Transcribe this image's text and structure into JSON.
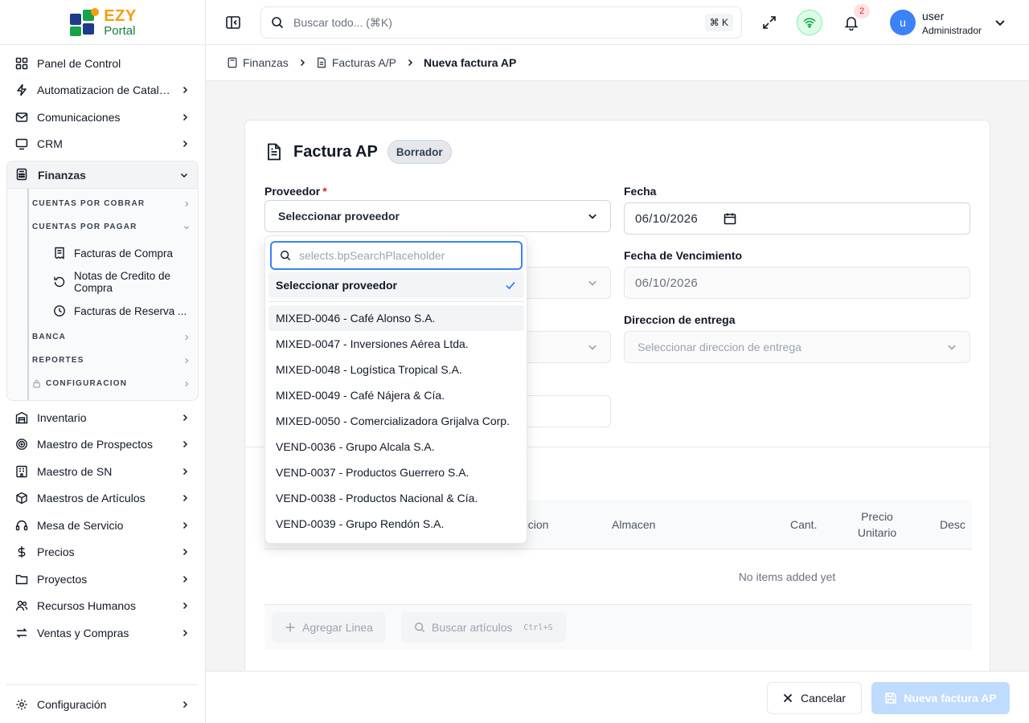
{
  "brand": {
    "name_top": "EZY",
    "name_bottom": "Portal"
  },
  "topbar": {
    "search_placeholder": "Buscar todo... (⌘K)",
    "search_shortcut": "⌘ K",
    "notification_count": "2",
    "user_initial": "u",
    "user_name": "user",
    "user_role": "Administrador"
  },
  "sidebar": {
    "items_top": [
      {
        "label": "Panel de Control",
        "icon": "layout-grid-icon"
      },
      {
        "label": "Automatizacion de Catalogos",
        "icon": "zap-icon"
      },
      {
        "label": "Comunicaciones",
        "icon": "mail-icon"
      },
      {
        "label": "CRM",
        "icon": "monitor-icon"
      }
    ],
    "finanzas": {
      "label": "Finanzas",
      "sub_cobrar": "CUENTAS POR COBRAR",
      "sub_pagar": "CUENTAS POR PAGAR",
      "pagar_items": [
        "Facturas de Compra",
        "Notas de Credito de Compra",
        "Facturas de Reserva ..."
      ],
      "sub_banca": "BANCA",
      "sub_reportes": "REPORTES",
      "sub_config": "CONFIGURACION"
    },
    "items_bottom": [
      {
        "label": "Inventario"
      },
      {
        "label": "Maestro de Prospectos"
      },
      {
        "label": "Maestro de SN"
      },
      {
        "label": "Maestros de Artículos"
      },
      {
        "label": "Mesa de Servicio"
      },
      {
        "label": "Precios"
      },
      {
        "label": "Proyectos"
      },
      {
        "label": "Recursos Humanos"
      },
      {
        "label": "Ventas y Compras"
      }
    ],
    "settings_label": "Configuración"
  },
  "breadcrumb": {
    "level1": "Finanzas",
    "level2": "Facturas A/P",
    "current": "Nueva factura AP"
  },
  "form": {
    "title": "Factura AP",
    "status": "Borrador",
    "proveedor_label": "Proveedor",
    "proveedor_value": "Seleccionar proveedor",
    "fecha_label": "Fecha",
    "fecha_value": "06/10/2026",
    "vencimiento_label": "Fecha de Vencimiento",
    "vencimiento_value": "06/10/2026",
    "entrega_label": "Direccion de entrega",
    "entrega_placeholder": "Seleccionar direccion de entrega"
  },
  "lines": {
    "columns": [
      "pcion",
      "Almacen",
      "Cant.",
      "Precio Unitario",
      "Desc"
    ],
    "empty_text": "No items added yet",
    "add_line_label": "Agregar Linea",
    "search_items_label": "Buscar artículos",
    "search_items_shortcut": "Ctrl+S"
  },
  "dropdown": {
    "search_placeholder": "selects.bpSearchPlaceholder",
    "selected_option": "Seleccionar proveedor",
    "options": [
      "MIXED-0046 - Café Alonso S.A.",
      "MIXED-0047 - Inversiones Aérea Ltda.",
      "MIXED-0048 - Logística Tropical S.A.",
      "MIXED-0049 - Café Nájera & Cía.",
      "MIXED-0050 - Comercializadora Grijalva Corp.",
      "VEND-0036 - Grupo Alcala S.A.",
      "VEND-0037 - Productos Guerrero S.A.",
      "VEND-0038 - Productos Nacional & Cía.",
      "VEND-0039 - Grupo Rendón S.A."
    ]
  },
  "footer": {
    "cancel_label": "Cancelar",
    "submit_label": "Nueva factura AP"
  },
  "colors": {
    "accent": "#3b82f6",
    "brand_orange": "#f59e0b",
    "brand_green": "#15803d",
    "danger": "#dc2626",
    "submit_disabled": "#bfdbfe"
  }
}
